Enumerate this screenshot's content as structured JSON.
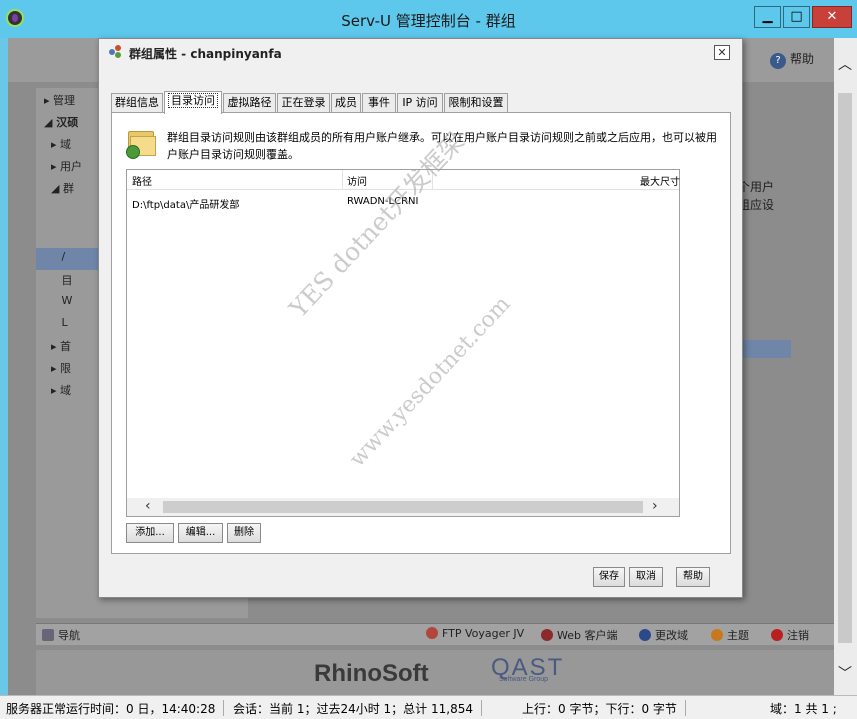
{
  "window": {
    "title": "Serv-U 管理控制台 - 群组",
    "minimize": "▁",
    "maximize": "□",
    "close": "✕"
  },
  "background": {
    "help_label": "帮助",
    "tree_items": [
      "管理",
      "汉硕",
      "域",
      "用户",
      "群",
      "/",
      "目",
      "W",
      "L",
      "首",
      "限",
      "域"
    ],
    "right_text_line1": "个用户",
    "right_text_line2": "组应设",
    "bottom_nav_label": "导航",
    "bottom_items": [
      "FTP Voyager JV",
      "Web 客户端",
      "更改域",
      "主题",
      "注销"
    ],
    "logo_rhinosoft": "RhinoSoft",
    "logo_qast": "QAST",
    "logo_qast_sub": "Software Group"
  },
  "statusbar": {
    "uptime": "服务器正常运行时间：0 日，14:40:28",
    "sessions": "会话：当前 1；过去24小时 1；总计 11,854",
    "transfer": "上行：0 字节；下行：0 字节",
    "domains": "域：1 共 1 ;"
  },
  "dialog": {
    "title": "群组属性 - chanpinyanfa",
    "close": "✕",
    "tabs": [
      "群组信息",
      "目录访问",
      "虚拟路径",
      "正在登录",
      "成员",
      "事件",
      "IP 访问",
      "限制和设置"
    ],
    "active_tab": 1,
    "description": "群组目录访问规则由该群组成员的所有用户账户继承。可以在用户账户目录访问规则之前或之后应用，也可以被用户账户目录访问规则覆盖。",
    "columns": [
      "路径",
      "访问",
      "最大尺寸"
    ],
    "rows": [
      {
        "path": "D:\\ftp\\data\\产品研发部",
        "access": "RWADN-LCRNI"
      }
    ],
    "buttons": {
      "add": "添加...",
      "edit": "编辑...",
      "delete": "删除",
      "save": "保存",
      "cancel": "取消",
      "help": "帮助"
    }
  },
  "watermark": {
    "line1": "YES dotnet开发框架",
    "line2": "www.yesdotnet.com"
  },
  "colors": {
    "titlebar": "#5ec8ec",
    "selection": "#6f86a8",
    "close_red": "#c7403a"
  }
}
